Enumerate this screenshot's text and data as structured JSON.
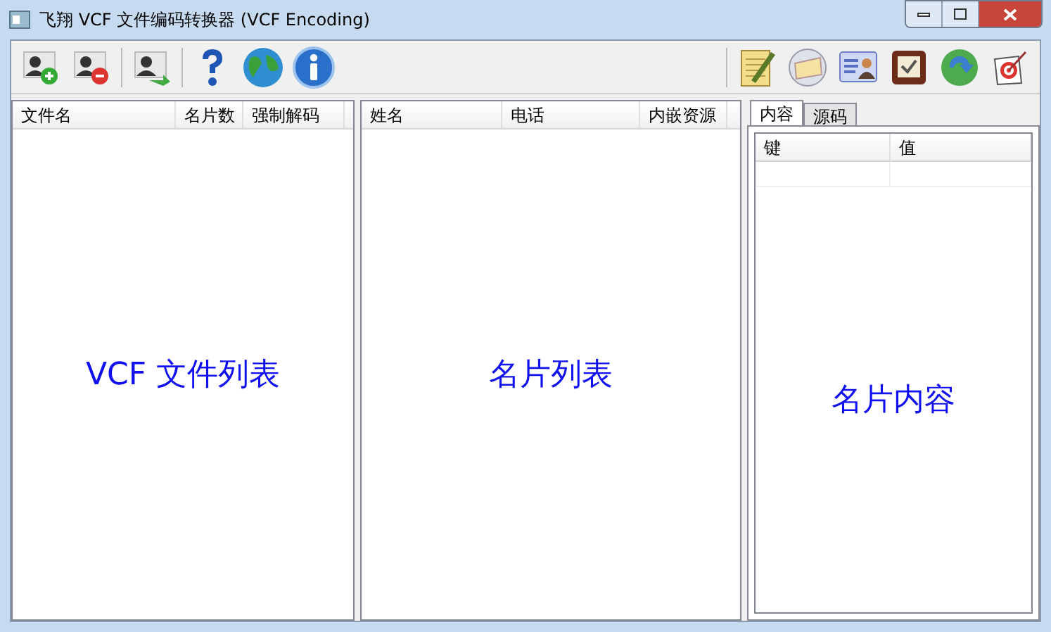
{
  "window": {
    "title": "飞翔 VCF 文件编码转换器 (VCF Encoding)"
  },
  "file_list": {
    "columns": [
      "文件名",
      "名片数",
      "强制解码"
    ],
    "caption": "VCF 文件列表"
  },
  "card_list": {
    "columns": [
      "姓名",
      "电话",
      "内嵌资源"
    ],
    "caption": "名片列表"
  },
  "card_content": {
    "tabs": [
      {
        "label": "内容",
        "selected": true
      },
      {
        "label": "源码",
        "selected": false
      }
    ],
    "columns": [
      "键",
      "值"
    ],
    "caption": "名片内容"
  }
}
